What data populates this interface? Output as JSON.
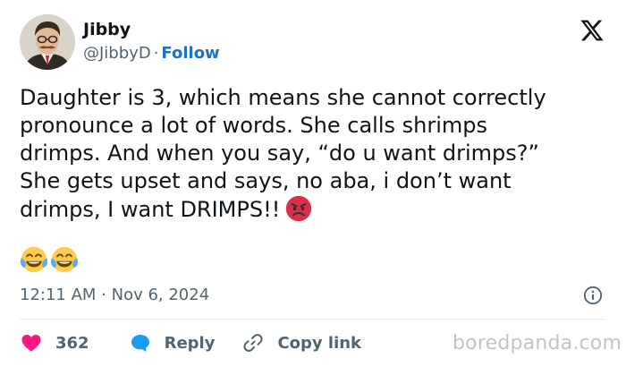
{
  "author": {
    "name": "Jibby",
    "handle": "@JibbyD",
    "separator": "·",
    "follow_label": "Follow"
  },
  "tweet": {
    "lines": [
      "Daughter is 3, which means she cannot correctly",
      "pronounce a lot of words. She calls shrimps",
      "drimps. And when you say, “do u want drimps?”",
      "She gets upset and says, no aba, i don’t want",
      "drimps, I want DRIMPS!!"
    ],
    "inline_emoji": "angry-face",
    "trailing_emojis": [
      "face-with-tears-of-joy",
      "face-with-tears-of-joy"
    ]
  },
  "timestamp": "12:11 AM · Nov 6, 2024",
  "actions": {
    "like_count": "362",
    "reply_label": "Reply",
    "copy_label": "Copy link"
  },
  "watermark": "boredpanda.com",
  "colors": {
    "accent": "#1d72c8",
    "like_heart": "#f91880",
    "reply_bubble": "#1d9bf0",
    "secondary_text": "#536471"
  }
}
